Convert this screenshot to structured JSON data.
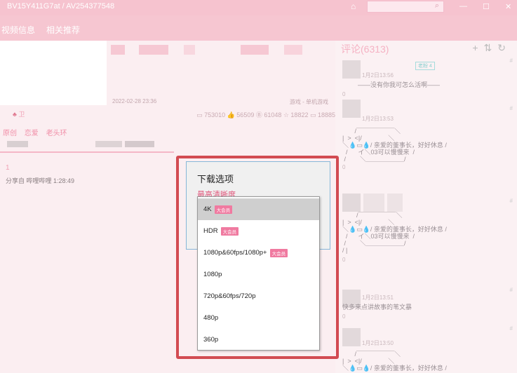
{
  "titlebar": {
    "title": "BV15Y411G7at / AV254377548",
    "window_controls": [
      "—",
      "☐",
      "✕"
    ]
  },
  "tabs": [
    "视频信息",
    "相关推荐"
  ],
  "video": {
    "date": "2022-02-28 23:36",
    "category": "游戏 - 单机游戏",
    "uploader": "卫",
    "stats": "▭ 753010  👍 56509  Ⓑ 61048  ☆ 18822  ▭ 18885",
    "tags": [
      "原创",
      "恋爱",
      "老头环"
    ],
    "part_index": "1",
    "share": "分享自 哔哩哔哩 1:28:49"
  },
  "comments": {
    "title": "评论(6313)",
    "icons": [
      "plus-icon",
      "sort-icon",
      "refresh-icon"
    ],
    "items": [
      {
        "time": "1月2日13:56",
        "badge": "老粉 4",
        "text": "——没有你我可怎么活啊——",
        "likes": "0"
      },
      {
        "time": "1月2日13:53",
        "badge": "",
        "text": "       /￣￣￣￣￣￣＼\n|  >  <|/               ＼\n＼💧▭💧/ 亲爱的董事长，好好休息 /\n  /      イ＼03可以慢慢来  /\n /        ＼＿＿＿＿＿＿/",
        "likes": "0"
      },
      {
        "time": "",
        "badge": "",
        "text": "        /￣￣￣￣￣￣＼\n|  >  <|/               ＼\n＼💧▭💧/ 亲爱的董事长，好好休息 /\n  /      イ＼03可以慢慢来  /\n /        ＼＿＿＿＿＿＿/\n/ |",
        "likes": "0"
      },
      {
        "time": "1月2日13:51",
        "badge": "",
        "text": "快多来点讲故事的苇文暴",
        "likes": "0"
      },
      {
        "time": "1月2日13:50",
        "badge": "",
        "text": "       /￣￣￣￣￣￣＼\n|  >  <|/               ＼\n＼💧▭💧/ 亲爱的董事长，好好休息 /",
        "likes": ""
      }
    ]
  },
  "download_dialog": {
    "title": "下载选项",
    "quality_label": "最高清晰度",
    "options": [
      {
        "label": "4K",
        "vip": "大会员",
        "selected": true
      },
      {
        "label": "HDR",
        "vip": "大会员",
        "selected": false
      },
      {
        "label": "1080p&60fps/1080p+",
        "vip": "大会员",
        "selected": false
      },
      {
        "label": "1080p",
        "vip": "",
        "selected": false
      },
      {
        "label": "720p&60fps/720p",
        "vip": "",
        "selected": false
      },
      {
        "label": "480p",
        "vip": "",
        "selected": false
      },
      {
        "label": "360p",
        "vip": "",
        "selected": false
      }
    ]
  },
  "colors": {
    "accent": "#f6c3cf",
    "highlight": "#d24b52",
    "vip": "#f07aa0"
  }
}
